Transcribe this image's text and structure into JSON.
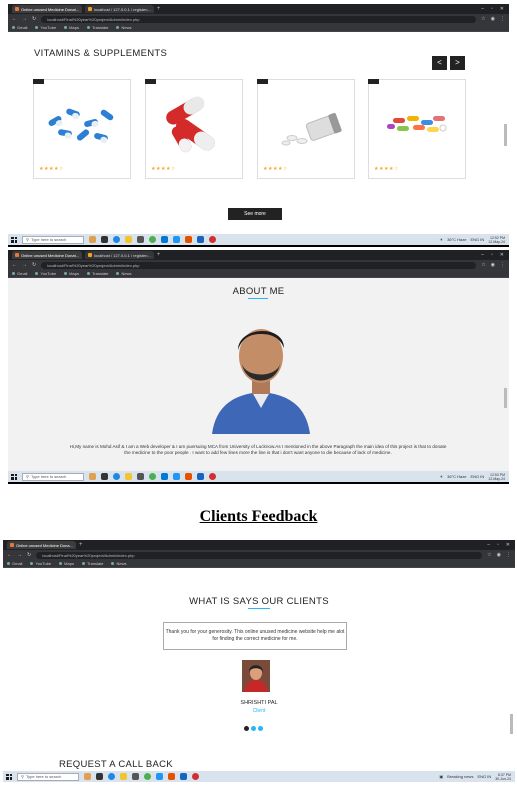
{
  "browser1": {
    "tabs": [
      "Online unused Medicine Donat...",
      "localhost / 127.0.0.1 / registen..."
    ],
    "url": "localhost/Final%20year%20project/Admin/index.php",
    "bookmarks": [
      "Gmail",
      "YouTube",
      "Maps",
      "Translate",
      "News"
    ]
  },
  "browser2": {
    "tabs": [
      "Online unused Medicine Donat...",
      "localhost / 127.0.0.1 / registen..."
    ],
    "url": "localhost/Final%20year%20project/Admin/index.php",
    "bookmarks": [
      "Gmail",
      "YouTube",
      "Maps",
      "Translate",
      "News"
    ]
  },
  "browser3": {
    "tabs": [
      "Online unused Medicine Dona..."
    ],
    "url": "localhost/Final%20year%20project/Admin/index.php",
    "bookmarks": [
      "Gmail",
      "YouTube",
      "Maps",
      "Translate",
      "News"
    ]
  },
  "taskbar1": {
    "search": "Type here to search",
    "weather": "36°C Haze",
    "time": "12:52 PM",
    "date": "12-May-24",
    "lang": "ENG IN"
  },
  "taskbar2": {
    "search": "Type here to search",
    "weather": "36°C Haze",
    "time": "12:53 PM",
    "date": "12-May-24",
    "lang": "ENG IN"
  },
  "taskbar3": {
    "search": "Type here to search",
    "weather": "Breaking news",
    "time": "8:37 PM",
    "date": "30-Jun-24",
    "lang": "ENG IN"
  },
  "vitamins": {
    "title": "VITAMINS & SUPPLEMENTS",
    "prev": "<",
    "next": ">",
    "rating": "★★★★☆",
    "see_more": "See more"
  },
  "about": {
    "title": "ABOUT ME",
    "text": "Hi,My name is Mohd Asif & I am a Web developer & I am puersuing MCA from University of Lucknow.As I mentioned in the above Paragraph the main idea of this project is that to donate the medicine to the poor people . I want to add few lines more the line is that i don't want anyone to die because of lack of medicine."
  },
  "section_heading": "Clients Feedback",
  "clients": {
    "title": "WHAT IS SAYS OUR CLIENTS",
    "quote": "Thank you for your generosity. This online unused medicine website help me alot for finding the correct medicine for me.",
    "name": "SHRISHTI PAL",
    "role": "Client",
    "next_section": "REQUEST A CALL BACK"
  },
  "colors": {
    "accent": "#29b6f6",
    "dark": "#222222",
    "star": "#f5a623"
  }
}
